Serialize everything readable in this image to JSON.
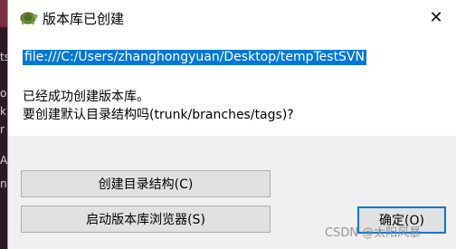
{
  "window": {
    "title": "版本库已创建",
    "close_glyph": "✕"
  },
  "message": {
    "url": "file:///C:/Users/zhanghongyuan/Desktop/tempTestSVN",
    "line1": "已经成功创建版本库。",
    "line2": "要创建默认目录结构吗(trunk/branches/tags)?"
  },
  "buttons": {
    "create_structure": "创建目录结构(C)",
    "start_browser": "启动版本库浏览器(S)",
    "ok": "确定(O)"
  },
  "background": {
    "fragments": [
      "ts",
      "o",
      "k",
      "r",
      "A",
      "n."
    ]
  },
  "watermark": "CSDN @太阳风暴",
  "colors": {
    "selection": "#0078d7",
    "dialog_bg": "#f0f0f0",
    "button_bg": "#e1e1e1",
    "desktop_bg": "#7a2f45"
  }
}
